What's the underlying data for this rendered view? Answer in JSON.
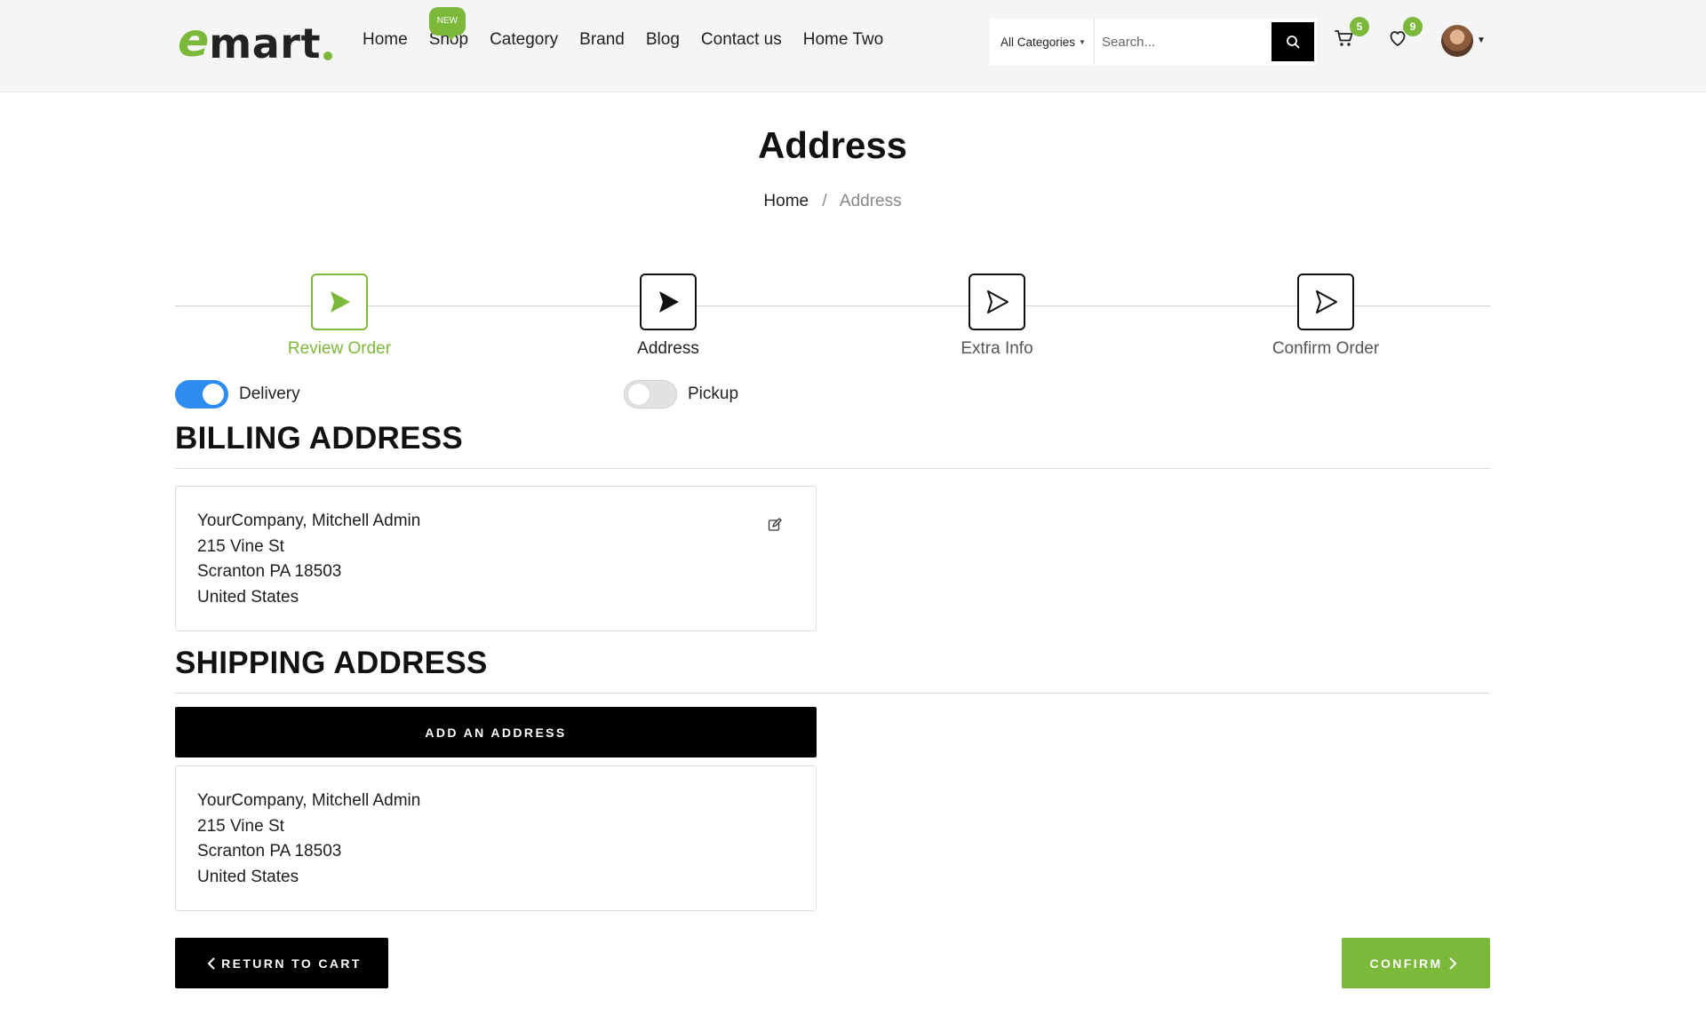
{
  "brand": {
    "logo_e": "e",
    "logo_rest": "mart",
    "accent": "#7cb83a"
  },
  "nav": {
    "items": [
      {
        "label": "Home",
        "badge": ""
      },
      {
        "label": "Shop",
        "badge": "NEW"
      },
      {
        "label": "Category",
        "badge": ""
      },
      {
        "label": "Brand",
        "badge": ""
      },
      {
        "label": "Blog",
        "badge": ""
      },
      {
        "label": "Contact us",
        "badge": ""
      },
      {
        "label": "Home Two",
        "badge": ""
      }
    ]
  },
  "search": {
    "category": "All Categories",
    "placeholder": "Search...",
    "icon": "search-icon"
  },
  "cart": {
    "count": "5",
    "icon": "cart-icon"
  },
  "wishlist": {
    "count": "9",
    "icon": "heart-icon"
  },
  "page": {
    "title": "Address"
  },
  "breadcrumb": {
    "home": "Home",
    "separator": "/",
    "current": "Address"
  },
  "steps": [
    {
      "label": "Review Order",
      "state": "done"
    },
    {
      "label": "Address",
      "state": "active"
    },
    {
      "label": "Extra Info",
      "state": "pending"
    },
    {
      "label": "Confirm Order",
      "state": "pending"
    }
  ],
  "delivery": {
    "delivery_label": "Delivery",
    "delivery_on": true,
    "pickup_label": "Pickup",
    "pickup_on": false
  },
  "billing": {
    "title": "BILLING ADDRESS",
    "lines": [
      "YourCompany, Mitchell Admin",
      "215 Vine St",
      "Scranton PA 18503",
      "United States"
    ]
  },
  "shipping": {
    "title": "SHIPPING ADDRESS",
    "add_label": "ADD AN ADDRESS",
    "lines": [
      "YourCompany, Mitchell Admin",
      "215 Vine St",
      "Scranton PA 18503",
      "United States"
    ]
  },
  "actions": {
    "return_label": "RETURN TO CART",
    "confirm_label": "CONFIRM"
  },
  "colors": {
    "toggle_on": "#2d8cf0",
    "button_dark": "#000000"
  }
}
